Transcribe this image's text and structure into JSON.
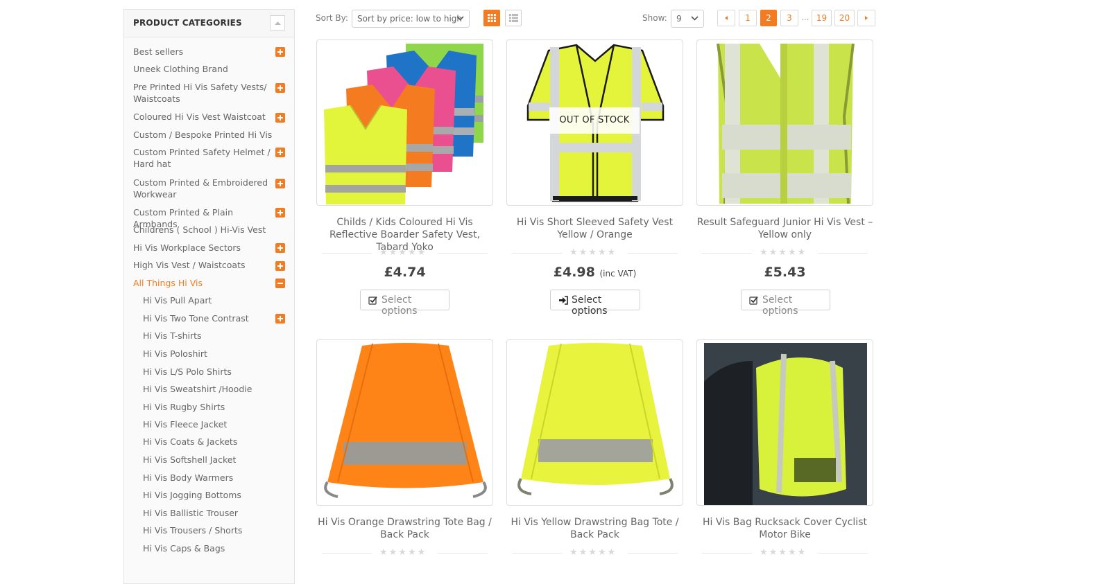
{
  "sidebar": {
    "title": "PRODUCT CATEGORIES",
    "items": [
      {
        "label": "Best sellers",
        "toggle": "plus"
      },
      {
        "label": "Uneek Clothing Brand",
        "toggle": ""
      },
      {
        "label": "Pre Printed Hi Vis Safety Vests/ Waistcoats",
        "toggle": "plus"
      },
      {
        "label": "Coloured Hi Vis Vest Waistcoat",
        "toggle": "plus"
      },
      {
        "label": "Custom / Bespoke Printed Hi Vis",
        "toggle": ""
      },
      {
        "label": "Custom Printed Safety Helmet / Hard hat",
        "toggle": "plus"
      },
      {
        "label": "Custom Printed & Embroidered Workwear",
        "toggle": "plus"
      },
      {
        "label": "Custom Printed & Plain Armbands",
        "toggle": "plus"
      },
      {
        "label": "Childrens ( School ) Hi-Vis Vest",
        "toggle": ""
      },
      {
        "label": "Hi Vis Workplace Sectors",
        "toggle": "plus"
      },
      {
        "label": "High Vis Vest / Waistcoats",
        "toggle": "plus"
      },
      {
        "label": "All Things Hi Vis",
        "toggle": "minus",
        "active": true
      }
    ],
    "subitems": [
      {
        "label": "Hi Vis Pull Apart",
        "toggle": ""
      },
      {
        "label": "Hi Vis Two Tone Contrast",
        "toggle": "plus"
      },
      {
        "label": "Hi Vis T-shirts",
        "toggle": ""
      },
      {
        "label": "Hi Vis Poloshirt",
        "toggle": ""
      },
      {
        "label": "Hi Vis L/S Polo Shirts",
        "toggle": ""
      },
      {
        "label": "Hi Vis Sweatshirt /Hoodie",
        "toggle": ""
      },
      {
        "label": "Hi Vis Rugby Shirts",
        "toggle": ""
      },
      {
        "label": "Hi Vis Fleece Jacket",
        "toggle": ""
      },
      {
        "label": "Hi Vis Coats & Jackets",
        "toggle": ""
      },
      {
        "label": "Hi Vis Softshell Jacket",
        "toggle": ""
      },
      {
        "label": "Hi Vis Body Warmers",
        "toggle": ""
      },
      {
        "label": "Hi Vis Jogging Bottoms",
        "toggle": ""
      },
      {
        "label": "Hi Vis Ballistic Trouser",
        "toggle": ""
      },
      {
        "label": "Hi Vis Trousers / Shorts",
        "toggle": ""
      },
      {
        "label": "Hi Vis Caps & Bags",
        "toggle": ""
      }
    ]
  },
  "toolbar": {
    "sort_label": "Sort By:",
    "sort_value": "Sort by price: low to high",
    "show_label": "Show:",
    "show_value": "9",
    "pages": [
      "1",
      "2",
      "3",
      "19",
      "20"
    ],
    "current_page": "2",
    "ellipsis": "..."
  },
  "products": [
    {
      "name": "Childs / Kids Coloured Hi Vis Reflective Boarder Safety Vest, Tabard Yoko",
      "price": "£4.74",
      "vat": "",
      "button": "Select options",
      "badge": ""
    },
    {
      "name": "Hi Vis Short Sleeved Safety Vest Yellow / Orange",
      "price": "£4.98",
      "vat": "(inc VAT)",
      "button": "Select options",
      "badge": "OUT OF STOCK"
    },
    {
      "name": "Result Safeguard Junior Hi Vis Vest – Yellow only",
      "price": "£5.43",
      "vat": "",
      "button": "Select options",
      "badge": ""
    },
    {
      "name": "Hi Vis Orange Drawstring Tote Bag / Back Pack",
      "price": "",
      "vat": "",
      "button": "",
      "badge": ""
    },
    {
      "name": "Hi Vis Yellow Drawstring Bag Tote / Back Pack",
      "price": "",
      "vat": "",
      "button": "",
      "badge": ""
    },
    {
      "name": "Hi Vis Bag Rucksack Cover Cyclist Motor Bike",
      "price": "",
      "vat": "",
      "button": "",
      "badge": ""
    }
  ],
  "colors": {
    "accent": "#f37c22",
    "hivis_yellow": "#dcf53a",
    "hivis_orange": "#ff8a1f"
  }
}
